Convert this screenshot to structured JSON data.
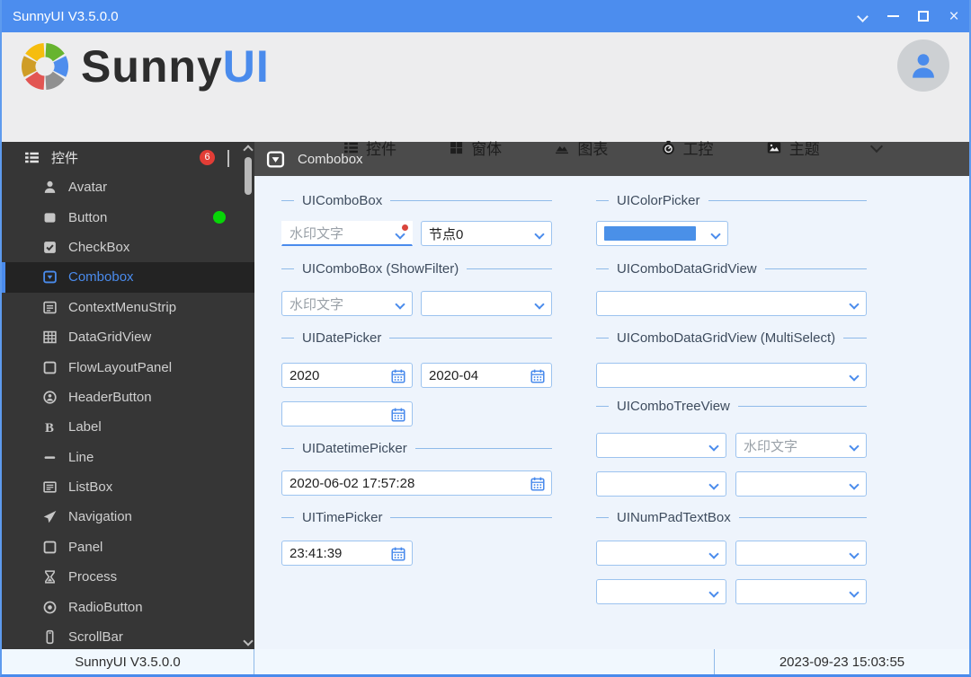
{
  "accent_color": "#4a8bec",
  "titlebar": {
    "title": "SunnyUI V3.5.0.0"
  },
  "header": {
    "logo_dark": "Sunny",
    "logo_blue": "UI",
    "nav": [
      {
        "label": "控件",
        "icon": "list-icon"
      },
      {
        "label": "窗体",
        "icon": "windows-icon"
      },
      {
        "label": "图表",
        "icon": "chart-icon"
      },
      {
        "label": "工控",
        "icon": "gauge-icon"
      },
      {
        "label": "主题",
        "icon": "image-icon"
      }
    ]
  },
  "sidebar": {
    "header": {
      "label": "控件",
      "badge": "6"
    },
    "items": [
      {
        "label": "Avatar"
      },
      {
        "label": "Button"
      },
      {
        "label": "CheckBox"
      },
      {
        "label": "Combobox"
      },
      {
        "label": "ContextMenuStrip"
      },
      {
        "label": "DataGridView"
      },
      {
        "label": "FlowLayoutPanel"
      },
      {
        "label": "HeaderButton"
      },
      {
        "label": "Label"
      },
      {
        "label": "Line"
      },
      {
        "label": "ListBox"
      },
      {
        "label": "Navigation"
      },
      {
        "label": "Panel"
      },
      {
        "label": "Process"
      },
      {
        "label": "RadioButton"
      },
      {
        "label": "ScrollBar"
      }
    ]
  },
  "content": {
    "page_title": "Combobox",
    "groups": {
      "ui_combobox": {
        "title": "UIComboBox",
        "combo1_placeholder": "水印文字",
        "combo2_value": "节点0"
      },
      "ui_colorpicker": {
        "title": "UIColorPicker",
        "swatch_color": "#4a90e8"
      },
      "ui_combobox_showfilter": {
        "title": "UIComboBox (ShowFilter)",
        "combo1_placeholder": "水印文字"
      },
      "ui_combodatagridview": {
        "title": "UIComboDataGridView"
      },
      "ui_datepicker": {
        "title": "UIDatePicker",
        "field1_value": "2020",
        "field2_value": "2020-04"
      },
      "ui_combodatagridview_multiselect": {
        "title": "UIComboDataGridView (MultiSelect)"
      },
      "ui_combotreeview": {
        "title": "UIComboTreeView",
        "combo2_placeholder": "水印文字"
      },
      "ui_datetimepicker": {
        "title": "UIDatetimePicker",
        "field_value": "2020-06-02 17:57:28"
      },
      "ui_timepicker": {
        "title": "UITimePicker",
        "field_value": "23:41:39"
      },
      "ui_numpadtextbox": {
        "title": "UINumPadTextBox"
      }
    }
  },
  "statusbar": {
    "left": "SunnyUI V3.5.0.0",
    "right": "2023-09-23 15:03:55"
  }
}
